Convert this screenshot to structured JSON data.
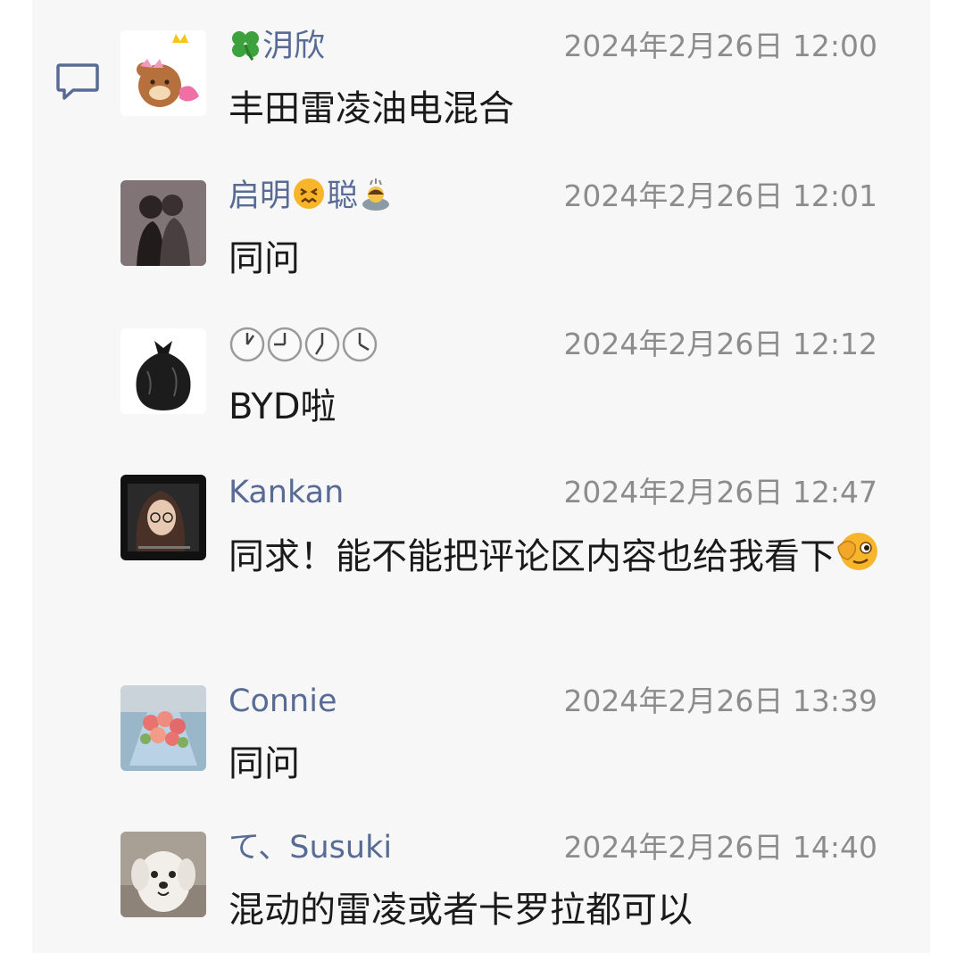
{
  "comments": [
    {
      "name_prefix_icon": "clover-icon",
      "name": "㳉欣",
      "time": "2024年2月26日 12:00",
      "text": "丰田雷凌油电混合",
      "avatar_icon": "cartoon-bear-with-crown-avatar"
    },
    {
      "name": "启明",
      "name_mid_icon": "confounded-face-emoji",
      "name_tail": "聪",
      "name_suffix_icon": "person-bowing-emoji",
      "time": "2024年2月26日 12:01",
      "text": "同问",
      "avatar_icon": "couple-photo-avatar"
    },
    {
      "name_icons": [
        "clock-one-icon",
        "clock-nine-icon",
        "clock-six-icon",
        "clock-four-icon"
      ],
      "time": "2024年2月26日 12:12",
      "text": "BYD啦",
      "avatar_icon": "black-trash-bag-avatar"
    },
    {
      "name": "Kankan",
      "time": "2024年2月26日 12:47",
      "text": "同求！能不能把评论区内容也给我看下",
      "text_suffix_icon": "face-with-hand-over-eye-emoji",
      "avatar_icon": "girl-with-glasses-avatar"
    },
    {
      "name": "Connie",
      "time": "2024年2月26日 13:39",
      "text": "同问",
      "avatar_icon": "flower-bouquet-avatar"
    },
    {
      "name": "て、Susuki",
      "time": "2024年2月26日 14:40",
      "text": "混动的雷凌或者卡罗拉都可以",
      "avatar_icon": "white-puppy-avatar"
    }
  ],
  "colors": {
    "name": "#576b95",
    "time": "#8c8c8c",
    "text": "#1a1a1a",
    "panel_bg": "#f7f7f7"
  }
}
